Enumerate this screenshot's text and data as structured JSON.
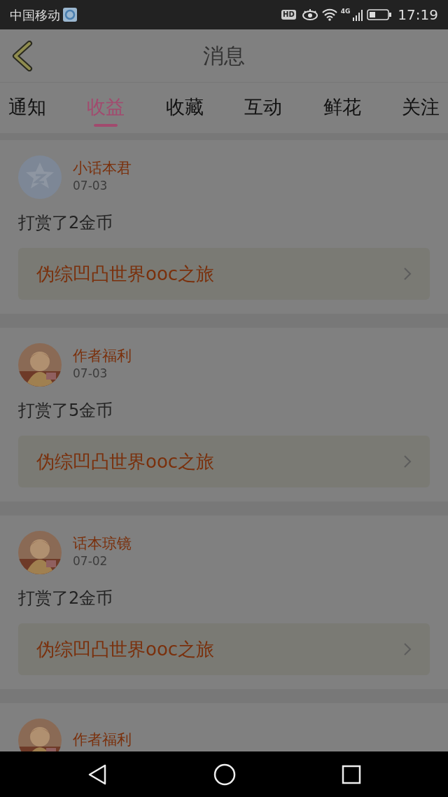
{
  "status_bar": {
    "carrier": "中国移动",
    "hd_badge": "HD",
    "network": "4G",
    "time": "17:19"
  },
  "header": {
    "title": "消息"
  },
  "tabs": [
    {
      "label": "通知",
      "selected": false
    },
    {
      "label": "收益",
      "selected": true
    },
    {
      "label": "收藏",
      "selected": false
    },
    {
      "label": "互动",
      "selected": false
    },
    {
      "label": "鲜花",
      "selected": false
    },
    {
      "label": "关注",
      "selected": false
    }
  ],
  "messages": [
    {
      "avatar": {
        "kind": "default"
      },
      "sender": "小话本君",
      "date": "07-03",
      "text": "打赏了2金币",
      "book": "伪综凹凸世界ooc之旅"
    },
    {
      "sender": "作者福利",
      "date": "07-03",
      "text": "打赏了5金币",
      "book": "伪综凹凸世界ooc之旅"
    },
    {
      "sender": "话本琼镜",
      "date": "07-02",
      "text": "打赏了2金币",
      "book": "伪综凹凸世界ooc之旅"
    },
    {
      "sender": "作者福利"
    }
  ]
}
